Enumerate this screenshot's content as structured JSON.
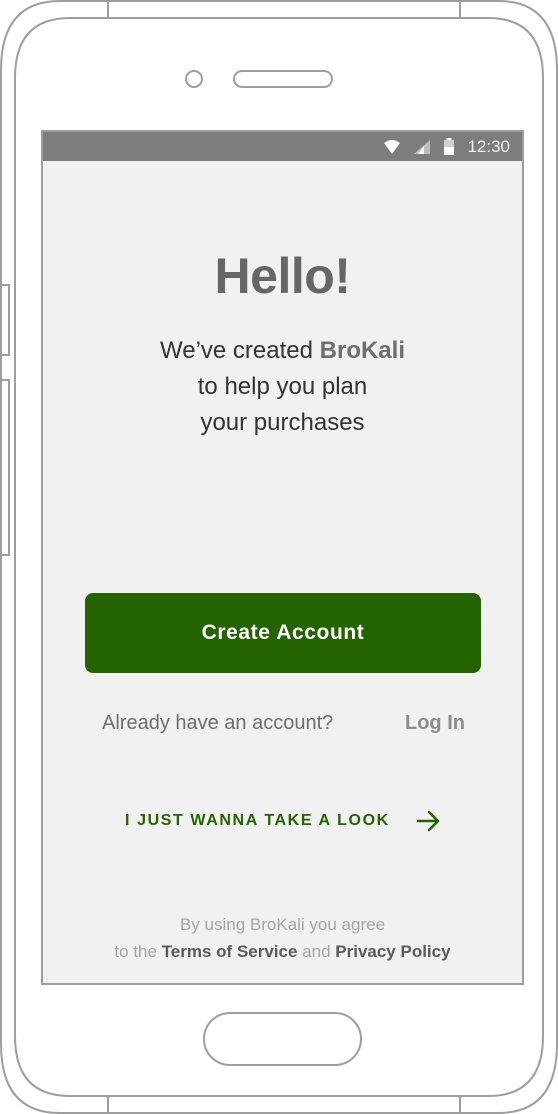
{
  "status_bar": {
    "time": "12:30",
    "icons": [
      "wifi-icon",
      "signal-icon",
      "battery-icon"
    ]
  },
  "welcome": {
    "title": "Hello!",
    "line1_prefix": "We’ve created ",
    "brand": "BroKali",
    "line2": "to help you plan",
    "line3": "your purchases"
  },
  "actions": {
    "create_account": "Create Account",
    "already_have_account": "Already have an account?",
    "log_in": "Log In",
    "just_look": "I JUST WANNA TAKE A LOOK"
  },
  "legal": {
    "line1": "By using BroKali you agree",
    "prefix": "to the ",
    "terms": "Terms of Service",
    "and": " and ",
    "privacy": "Privacy Policy"
  },
  "colors": {
    "accent": "#246400",
    "screen_bg": "#f1f1f1",
    "status_bar": "#7d7d7d"
  }
}
